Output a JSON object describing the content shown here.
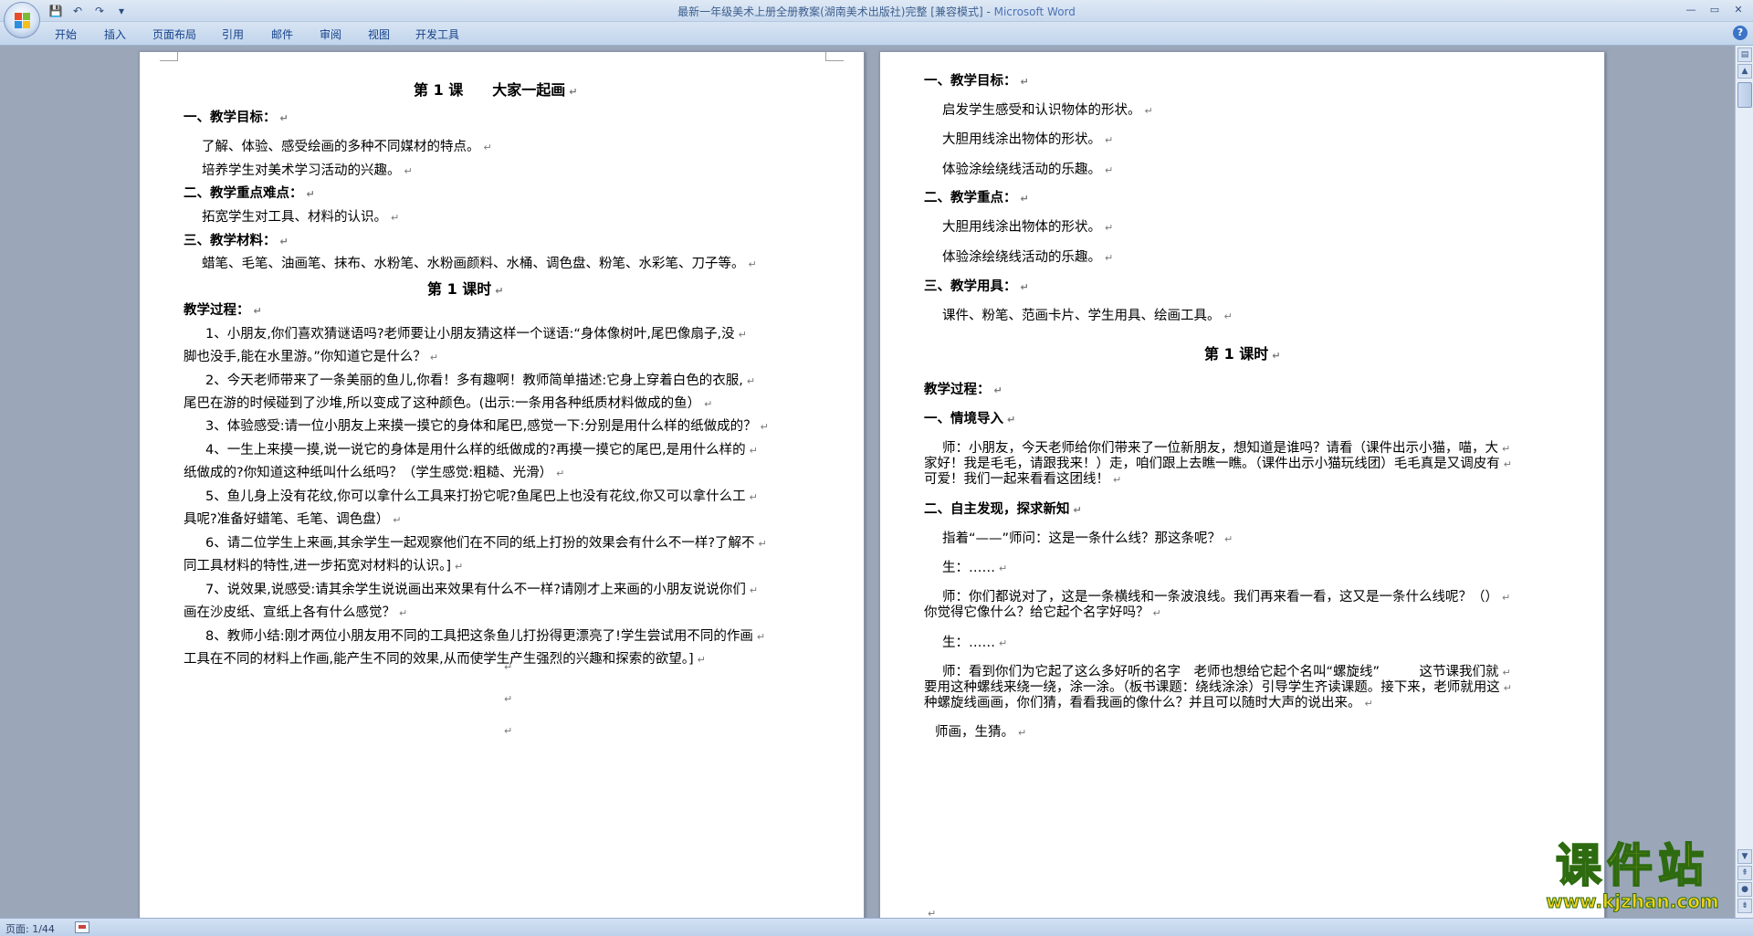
{
  "window": {
    "title": "最新一年级美术上册全册教案(湖南美术出版社)完整 [兼容模式]",
    "title_separator": " - ",
    "app_name": "Microsoft Word"
  },
  "qat": {
    "save_icon": "💾",
    "undo_icon": "↶",
    "redo_icon": "↷",
    "customize_icon": "▾"
  },
  "window_controls": {
    "minimize": "—",
    "maximize": "▭",
    "close": "✕"
  },
  "ribbon": {
    "tabs": [
      "开始",
      "插入",
      "页面布局",
      "引用",
      "邮件",
      "审阅",
      "视图",
      "开发工具"
    ],
    "help_icon": "?"
  },
  "return_mark": "↵",
  "page1": {
    "title": "第 1 课　　大家一起画",
    "lines": [
      {
        "text": "一、教学目标：",
        "bold": true
      },
      {
        "text": "了解、体验、感受绘画的多种不同媒材的特点。",
        "bold": false
      },
      {
        "text": "培养学生对美术学习活动的兴趣。",
        "bold": false
      },
      {
        "text": "二、教学重点难点：",
        "bold": true
      },
      {
        "text": "拓宽学生对工具、材料的认识。",
        "bold": false
      },
      {
        "text": "三、教学材料：",
        "bold": true
      },
      {
        "text": "蜡笔、毛笔、油画笔、抹布、水粉笔、水粉画颜料、水桶、调色盘、粉笔、水彩笔、刀子等。",
        "bold": false
      },
      {
        "text": "第 1 课时",
        "bold": true
      },
      {
        "text": "教学过程：",
        "bold": true
      },
      {
        "text": "1、小朋友,你们喜欢猜谜语吗?老师要让小朋友猜这样一个谜语:“身体像树叶,尾巴像扇子,没",
        "bold": false
      },
      {
        "text": "脚也没手,能在水里游。”你知道它是什么？",
        "bold": false
      },
      {
        "text": "2、今天老师带来了一条美丽的鱼儿,你看！多有趣啊！教师简单描述:它身上穿着白色的衣服,",
        "bold": false
      },
      {
        "text": "尾巴在游的时候碰到了沙堆,所以变成了这种颜色。(出示:一条用各种纸质材料做成的鱼）",
        "bold": false
      },
      {
        "text": "3、体验感受:请一位小朋友上来摸一摸它的身体和尾巴,感觉一下:分别是用什么样的纸做成的？",
        "bold": false
      },
      {
        "text": "4、一生上来摸一摸,说一说它的身体是用什么样的纸做成的?再摸一摸它的尾巴,是用什么样的",
        "bold": false
      },
      {
        "text": "纸做成的?你知道这种纸叫什么纸吗？（学生感觉:粗糙、光滑）",
        "bold": false
      },
      {
        "text": "5、鱼儿身上没有花纹,你可以拿什么工具来打扮它呢?鱼尾巴上也没有花纹,你又可以拿什么工",
        "bold": false
      },
      {
        "text": "具呢?准备好蜡笔、毛笔、调色盘）",
        "bold": false
      },
      {
        "text": "6、请二位学生上来画,其余学生一起观察他们在不同的纸上打扮的效果会有什么不一样?了解不",
        "bold": false
      },
      {
        "text": "同工具材料的特性,进一步拓宽对材料的认识。]",
        "bold": false
      },
      {
        "text": "7、说效果,说感受:请其余学生说说画出来效果有什么不一样?请刚才上来画的小朋友说说你们",
        "bold": false
      },
      {
        "text": "画在沙皮纸、宣纸上各有什么感觉？",
        "bold": false
      },
      {
        "text": "8、教师小结:刚才两位小朋友用不同的工具把这条鱼儿打扮得更漂亮了!学生尝试用不同的作画",
        "bold": false
      },
      {
        "text": "工具在不同的材料上作画,能产生不同的效果,从而使学生产生强烈的兴趣和探索的欲望。]",
        "bold": false
      }
    ]
  },
  "page2": {
    "lines": [
      {
        "text": "一、教学目标：",
        "bold": true
      },
      {
        "text": "启发学生感受和认识物体的形状。",
        "bold": false
      },
      {
        "text": "大胆用线涂出物体的形状。",
        "bold": false
      },
      {
        "text": "体验涂绘绕线活动的乐趣。",
        "bold": false
      },
      {
        "text": "二、教学重点：",
        "bold": true
      },
      {
        "text": "大胆用线涂出物体的形状。",
        "bold": false
      },
      {
        "text": "体验涂绘绕线活动的乐趣。",
        "bold": false
      },
      {
        "text": "三、教学用具：",
        "bold": true
      },
      {
        "text": "课件、粉笔、范画卡片、学生用具、绘画工具。",
        "bold": false
      },
      {
        "text": "第 1 课时",
        "bold": true
      },
      {
        "text": "教学过程：",
        "bold": true
      },
      {
        "text": "一、情境导入",
        "bold": true
      },
      {
        "text": "师：小朋友，今天老师给你们带来了一位新朋友，想知道是谁吗？请看（课件出示小猫，喵，大",
        "bold": false
      },
      {
        "text": "家好！我是毛毛，请跟我来！）走，咱们跟上去瞧一瞧。（课件出示小猫玩线团）毛毛真是又调皮有",
        "bold": false
      },
      {
        "text": "可爱！我们一起来看看这团线！",
        "bold": false
      },
      {
        "text": "二、自主发现，探求新知",
        "bold": true
      },
      {
        "text": "指着“——”师问：这是一条什么线？那这条呢？",
        "bold": false
      },
      {
        "text": "生：……",
        "bold": false
      },
      {
        "text": "师：你们都说对了，这是一条横线和一条波浪线。我们再来看一看，这又是一条什么线呢？（）",
        "bold": false
      },
      {
        "text": "你觉得它像什么？给它起个名字好吗？",
        "bold": false
      },
      {
        "text": "生：……",
        "bold": false
      },
      {
        "text": "师：看到你们为它起了这么多好听的名字　老师也想给它起个名叫“螺旋线”　　　这节课我们就",
        "bold": false
      },
      {
        "text": "要用这种螺线来绕一绕，涂一涂。（板书课题：绕线涂涂）引导学生齐读课题。接下来，老师就用这",
        "bold": false
      },
      {
        "text": "种螺旋线画画，你们猜，看看我画的像什么？并且可以随时大声的说出来。",
        "bold": false
      },
      {
        "text": "师画，生猜。",
        "bold": false
      }
    ]
  },
  "status": {
    "page_count": "页面: 1/44"
  },
  "watermark": {
    "main": "课件站",
    "url": "www.kjzhan.com"
  }
}
